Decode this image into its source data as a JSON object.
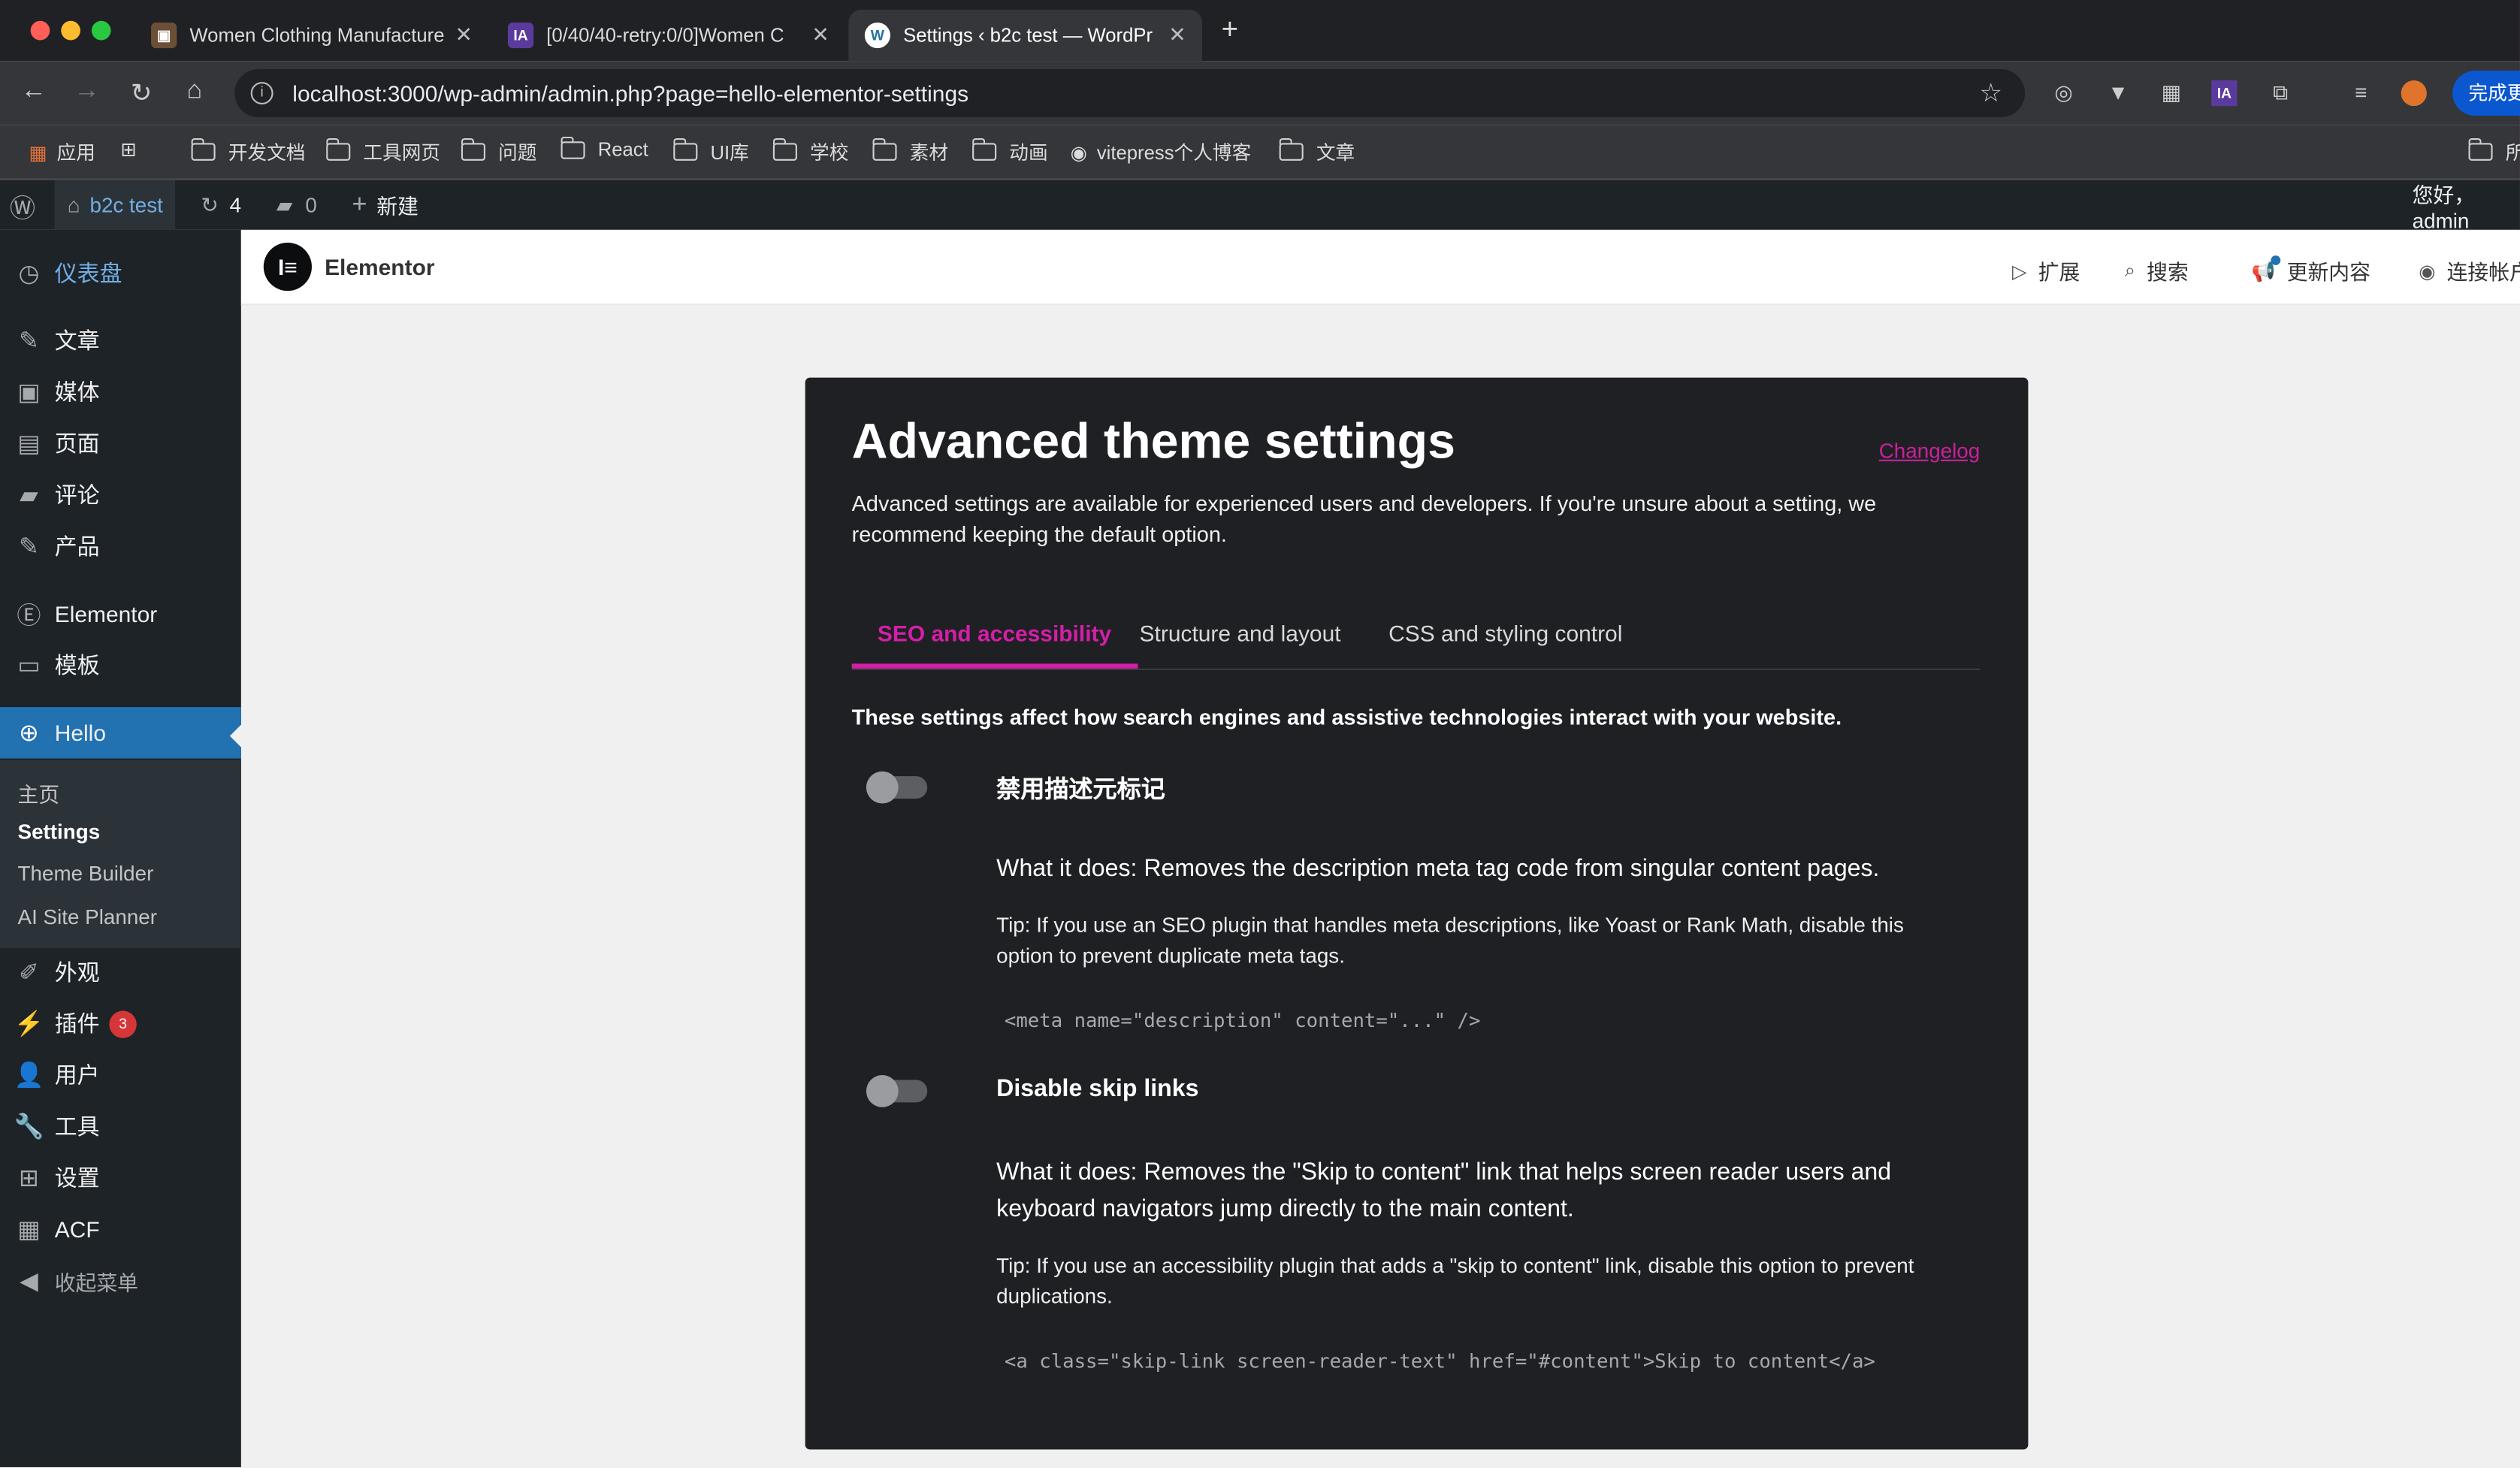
{
  "browser": {
    "tabs": [
      {
        "title": "Women Clothing Manufacture",
        "favicon": "📷"
      },
      {
        "title": "[0/40/40-retry:0/0]Women C",
        "favicon": "IA"
      },
      {
        "title": "Settings ‹ b2c test — WordPr",
        "favicon": "W"
      }
    ],
    "url": "localhost:3000/wp-admin/admin.php?page=hello-elementor-settings",
    "finish_button": "完成更",
    "bookmarks": [
      "应用",
      "开发文档",
      "工具网页",
      "问题",
      "React",
      "UI库",
      "学校",
      "素材",
      "动画",
      "vitepress个人博客",
      "文章",
      "所"
    ]
  },
  "adminbar": {
    "site_name": "b2c test",
    "updates_count": "4",
    "comments_count": "0",
    "new_label": "新建",
    "greeting": "您好，admin"
  },
  "sidebar": {
    "items": [
      {
        "label": "仪表盘",
        "icon": "dashboard-icon"
      },
      {
        "label": "文章",
        "icon": "pin-icon"
      },
      {
        "label": "媒体",
        "icon": "media-icon"
      },
      {
        "label": "页面",
        "icon": "page-icon"
      },
      {
        "label": "评论",
        "icon": "comment-icon"
      },
      {
        "label": "产品",
        "icon": "pin-icon"
      },
      {
        "label": "Elementor",
        "icon": "elementor-icon"
      },
      {
        "label": "模板",
        "icon": "folder-icon"
      },
      {
        "label": "Hello",
        "icon": "plus-circle-icon"
      },
      {
        "label": "外观",
        "icon": "brush-icon"
      },
      {
        "label": "插件",
        "icon": "plugin-icon",
        "badge": "3"
      },
      {
        "label": "用户",
        "icon": "user-icon"
      },
      {
        "label": "工具",
        "icon": "wrench-icon"
      },
      {
        "label": "设置",
        "icon": "settings-icon"
      },
      {
        "label": "ACF",
        "icon": "grid-icon"
      },
      {
        "label": "收起菜单",
        "icon": "collapse-icon"
      }
    ],
    "submenu": [
      "主页",
      "Settings",
      "Theme Builder",
      "AI Site Planner"
    ]
  },
  "elementor_bar": {
    "title": "Elementor",
    "links": [
      "扩展",
      "搜索",
      "更新内容",
      "连接帐户"
    ]
  },
  "panel": {
    "title": "Advanced theme settings",
    "changelog": "Changelog",
    "description": "Advanced settings are available for experienced users and developers. If you're unsure about a setting, we recommend keeping the default option.",
    "tabs": [
      "SEO and accessibility",
      "Structure and layout",
      "CSS and styling control"
    ],
    "intro": "These settings affect how search engines and assistive technologies interact with your website.",
    "options": [
      {
        "title": "禁用描述元标记",
        "what": "What it does: Removes the description meta tag code from singular content pages.",
        "tip": "Tip: If you use an SEO plugin that handles meta descriptions, like Yoast or Rank Math, disable this option to prevent duplicate meta tags.",
        "code": "<meta name=\"description\" content=\"...\" />",
        "enabled": false
      },
      {
        "title": "Disable skip links",
        "what": "What it does: Removes the \"Skip to content\" link that helps screen reader users and keyboard navigators jump directly to the main content.",
        "tip": "Tip: If you use an accessibility plugin that adds a \"skip to content\" link, disable this option to prevent duplications.",
        "code": "<a class=\"skip-link screen-reader-text\" href=\"#content\">Skip to content</a>",
        "enabled": false
      }
    ]
  },
  "colors": {
    "accent": "#d51ea8",
    "wp_blue": "#2271b1",
    "admin_dark": "#1d2327"
  }
}
